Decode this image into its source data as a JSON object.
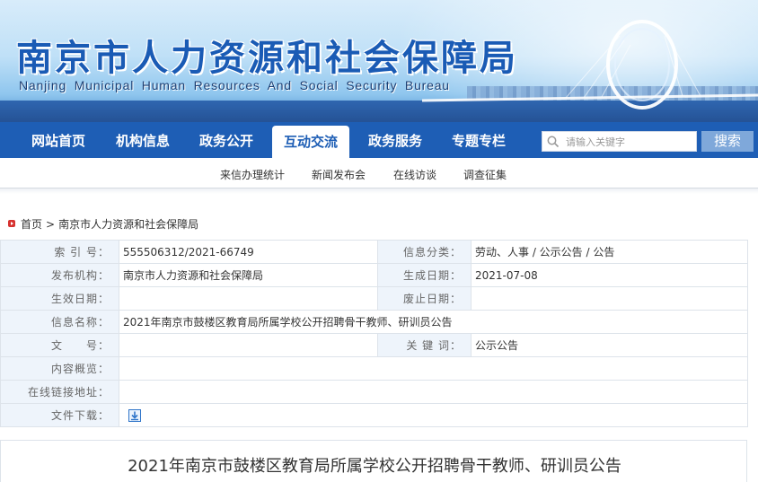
{
  "header": {
    "title": "南京市人力资源和社会保障局",
    "subtitle": "Nanjing Municipal Human Resources And Social Security Bureau"
  },
  "nav": {
    "items": [
      "网站首页",
      "机构信息",
      "政务公开",
      "互动交流",
      "政务服务",
      "专题专栏"
    ],
    "active": "互动交流"
  },
  "search": {
    "placeholder": "请输入关键字",
    "button_label": "搜索"
  },
  "subnav": {
    "items": [
      "来信办理统计",
      "新闻发布会",
      "在线访谈",
      "调查征集"
    ]
  },
  "breadcrumb": {
    "home": "首页",
    "separator": ">",
    "current": "南京市人力资源和社会保障局"
  },
  "info": {
    "index_label": "索 引 号：",
    "index_value": "555506312/2021-66749",
    "category_label": "信息分类：",
    "category_value": "劳动、人事 / 公示公告 / 公告",
    "org_label": "发布机构：",
    "org_value": "南京市人力资源和社会保障局",
    "created_label": "生成日期：",
    "created_value": "2021-07-08",
    "effective_label": "生效日期：",
    "effective_value": "",
    "repeal_label": "废止日期：",
    "repeal_value": "",
    "name_label": "信息名称：",
    "name_value": "2021年南京市鼓楼区教育局所属学校公开招聘骨干教师、研训员公告",
    "docno_label": "文　　号：",
    "docno_value": "",
    "keywords_label": "关 键 词：",
    "keywords_value": "公示公告",
    "summary_label": "内容概览：",
    "summary_value": "",
    "link_label": "在线链接地址：",
    "link_value": "",
    "download_label": "文件下载：",
    "download_icon": "download-icon"
  },
  "article": {
    "title": "2021年南京市鼓楼区教育局所属学校公开招聘骨干教师、研训员公告"
  },
  "colors": {
    "nav_bg": "#1e5eb5",
    "title_blue": "#1a5bb5",
    "label_bg": "#eef4fb",
    "search_button": "#7fa8da"
  }
}
